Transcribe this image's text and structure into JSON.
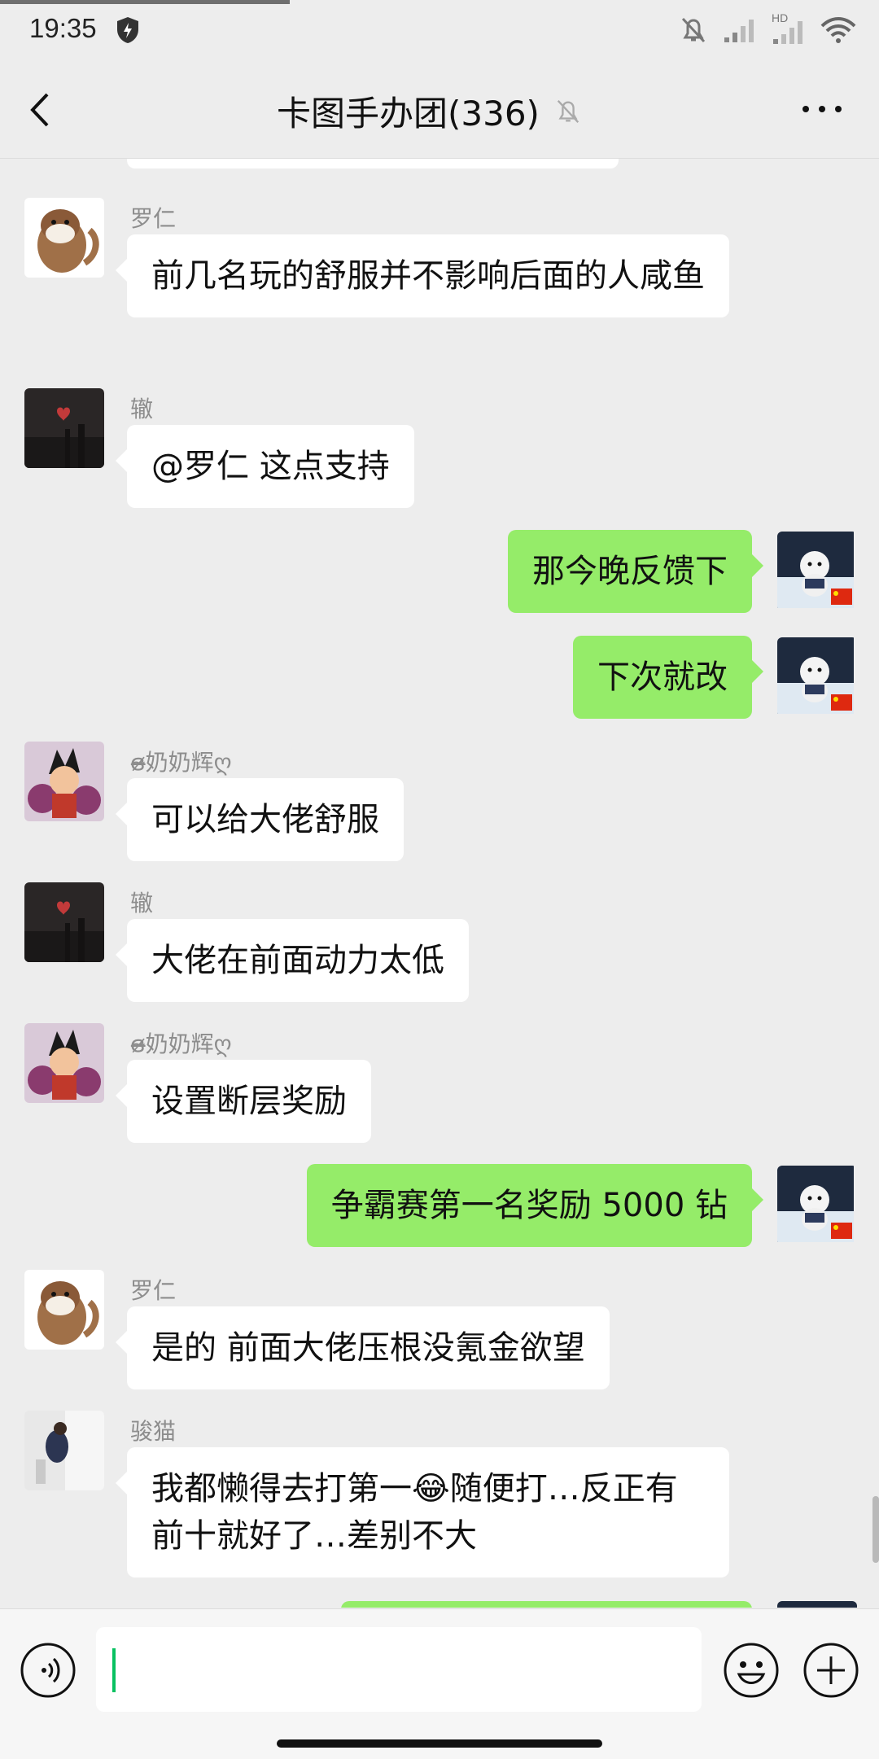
{
  "status_bar": {
    "time": "19:35",
    "hd_label": "HD"
  },
  "header": {
    "title": "卡图手办团(336)"
  },
  "messages": [
    {
      "sender": "罗仁",
      "text": "前几名玩的舒服并不影响后面的人咸鱼",
      "side": "left"
    },
    {
      "sender": "辙",
      "text": "@罗仁  这点支持",
      "side": "left"
    },
    {
      "sender": "",
      "text": "那今晚反馈下",
      "side": "right"
    },
    {
      "sender": "",
      "text": "下次就改",
      "side": "right"
    },
    {
      "sender": "ɞ̴̶̷奶奶辉ღ",
      "text": "可以给大佬舒服",
      "side": "left"
    },
    {
      "sender": "辙",
      "text": "大佬在前面动力太低",
      "side": "left"
    },
    {
      "sender": "ɞ̴̶̷奶奶辉ღ",
      "text": "设置断层奖励",
      "side": "left"
    },
    {
      "sender": "",
      "text": "争霸赛第一名奖励 5000 钻",
      "side": "right"
    },
    {
      "sender": "罗仁",
      "text": "是的 前面大佬压根没氪金欲望",
      "side": "left"
    },
    {
      "sender": "骏猫",
      "text_a": "我都懒得去打第一",
      "emoji": "😂",
      "text_b": "随便打…反正有前十就好了…差别不大",
      "side": "left"
    }
  ],
  "input": {
    "value": ""
  },
  "colors": {
    "bg": "#ededed",
    "bubble_me": "#95ec69",
    "bubble_other": "#ffffff",
    "accent": "#07c160"
  },
  "icons": [
    "back-arrow-icon",
    "mute-bell-icon",
    "more-dots-icon",
    "voice-icon",
    "emoji-icon",
    "plus-icon",
    "shield-icon",
    "signal-icon",
    "wifi-icon"
  ]
}
